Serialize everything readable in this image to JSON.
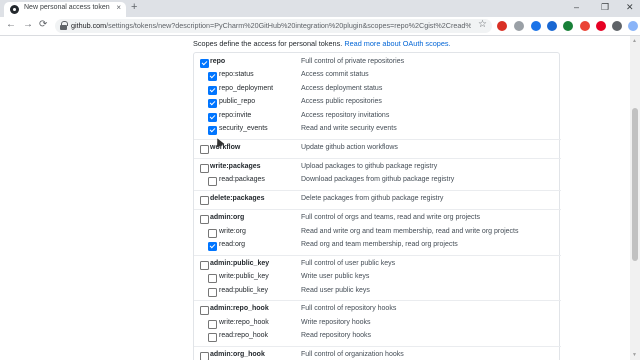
{
  "browser": {
    "tab_title": "New personal access token",
    "tab_close": "×",
    "new_tab": "+",
    "window_controls": [
      "–",
      "❐",
      "✕"
    ],
    "nav": {
      "back": "←",
      "forward": "→",
      "reload": "⟳"
    },
    "url_host": "github.com",
    "url_rest": "/settings/tokens/new?description=PyCharm%20GitHub%20integration%20plugin&scopes=repo%2Cgist%2Cread%3...",
    "star": "☆",
    "extensions": [
      {
        "name": "abp-extension-icon",
        "color": "#d93025"
      },
      {
        "name": "grey-extension-icon",
        "color": "#9aa0a6"
      },
      {
        "name": "blue-extension-icon",
        "color": "#1a73e8"
      },
      {
        "name": "iq-extension-icon",
        "color": "#1967d2"
      },
      {
        "name": "bookmark-extension-icon",
        "color": "#188038"
      },
      {
        "name": "red-badge-extension-icon",
        "color": "#ea4335"
      },
      {
        "name": "pinterest-extension-icon",
        "color": "#e60023"
      },
      {
        "name": "puzzle-extension-icon",
        "color": "#5f6368"
      },
      {
        "name": "avatar-extension-icon",
        "color": "#8ab4f8"
      },
      {
        "name": "menu-extension-icon",
        "color": "#5f6368"
      }
    ]
  },
  "page": {
    "intro_text": "Scopes define the access for personal tokens.",
    "intro_link": "Read more about OAuth scopes.",
    "scopes": [
      {
        "name": "repo",
        "desc": "Full control of private repositories",
        "checked": true,
        "parent": true
      },
      {
        "name": "repo:status",
        "desc": "Access commit status",
        "checked": true,
        "parent": false
      },
      {
        "name": "repo_deployment",
        "desc": "Access deployment status",
        "checked": true,
        "parent": false
      },
      {
        "name": "public_repo",
        "desc": "Access public repositories",
        "checked": true,
        "parent": false
      },
      {
        "name": "repo:invite",
        "desc": "Access repository invitations",
        "checked": true,
        "parent": false
      },
      {
        "name": "security_events",
        "desc": "Read and write security events",
        "checked": true,
        "parent": false
      },
      {
        "name": "workflow",
        "desc": "Update github action workflows",
        "checked": false,
        "parent": true
      },
      {
        "name": "write:packages",
        "desc": "Upload packages to github package registry",
        "checked": false,
        "parent": true
      },
      {
        "name": "read:packages",
        "desc": "Download packages from github package registry",
        "checked": false,
        "parent": false
      },
      {
        "name": "delete:packages",
        "desc": "Delete packages from github package registry",
        "checked": false,
        "parent": true
      },
      {
        "name": "admin:org",
        "desc": "Full control of orgs and teams, read and write org projects",
        "checked": false,
        "parent": true
      },
      {
        "name": "write:org",
        "desc": "Read and write org and team membership, read and write org projects",
        "checked": false,
        "parent": false
      },
      {
        "name": "read:org",
        "desc": "Read org and team membership, read org projects",
        "checked": true,
        "parent": false
      },
      {
        "name": "admin:public_key",
        "desc": "Full control of user public keys",
        "checked": false,
        "parent": true
      },
      {
        "name": "write:public_key",
        "desc": "Write user public keys",
        "checked": false,
        "parent": false
      },
      {
        "name": "read:public_key",
        "desc": "Read user public keys",
        "checked": false,
        "parent": false
      },
      {
        "name": "admin:repo_hook",
        "desc": "Full control of repository hooks",
        "checked": false,
        "parent": true
      },
      {
        "name": "write:repo_hook",
        "desc": "Write repository hooks",
        "checked": false,
        "parent": false
      },
      {
        "name": "read:repo_hook",
        "desc": "Read repository hooks",
        "checked": false,
        "parent": false
      },
      {
        "name": "admin:org_hook",
        "desc": "Full control of organization hooks",
        "checked": false,
        "parent": true
      }
    ]
  }
}
